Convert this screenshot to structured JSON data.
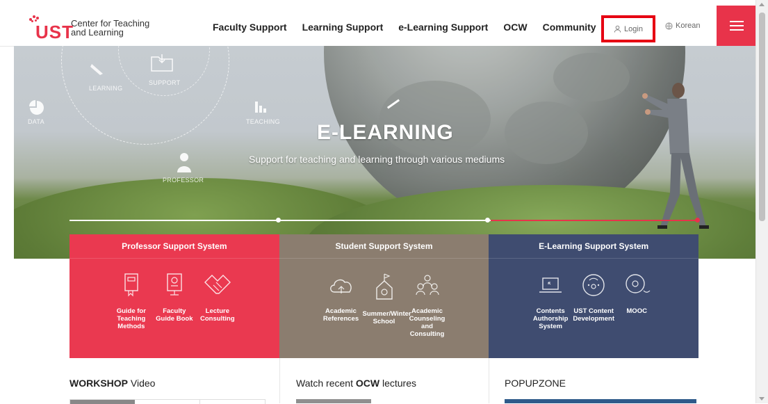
{
  "header": {
    "logo_text": "UST",
    "center_name_line1": "Center for Teaching",
    "center_name_line2": "and Learning",
    "nav": [
      "Faculty Support",
      "Learning Support",
      "e-Learning Support",
      "OCW",
      "Community"
    ],
    "login_label": "Login",
    "language_label": "Korean",
    "accent_color": "#e8334a"
  },
  "hero": {
    "title": "E-LEARNING",
    "subtitle": "Support for teaching and learning through various mediums",
    "circle_labels": {
      "learning": "LEARNING",
      "support": "SUPPORT",
      "data": "DATA",
      "teaching": "TEACHING",
      "professor": "PROFESSOR"
    },
    "slide_progress": 0.33
  },
  "panels": [
    {
      "title": "Professor Support System",
      "color": "#ea3950",
      "items": [
        {
          "label": "Guide for Teaching Methods",
          "icon": "book-icon"
        },
        {
          "label": "Faculty Guide Book",
          "icon": "presentation-board-icon"
        },
        {
          "label": "Lecture Consulting",
          "icon": "handshake-icon"
        }
      ]
    },
    {
      "title": "Student Support System",
      "color": "#8b7d6f",
      "items": [
        {
          "label": "Academic References",
          "icon": "cloud-upload-icon"
        },
        {
          "label": "Summer/Winter School",
          "icon": "school-flag-icon"
        },
        {
          "label": "Academic Counseling and Consulting",
          "icon": "people-group-icon"
        }
      ]
    },
    {
      "title": "E-Learning Support System",
      "color": "#3f4c70",
      "items": [
        {
          "label": "Contents Authorship System",
          "icon": "laptop-icon"
        },
        {
          "label": "UST Content Development",
          "icon": "gauge-icon"
        },
        {
          "label": "MOOC",
          "icon": "disc-icon"
        }
      ]
    }
  ],
  "sections": {
    "workshop_bold": "WORKSHOP",
    "workshop_rest": " Video",
    "ocw_prefix": "Watch recent ",
    "ocw_bold": "OCW",
    "ocw_suffix": " lectures",
    "popup": "POPUPZONE"
  }
}
